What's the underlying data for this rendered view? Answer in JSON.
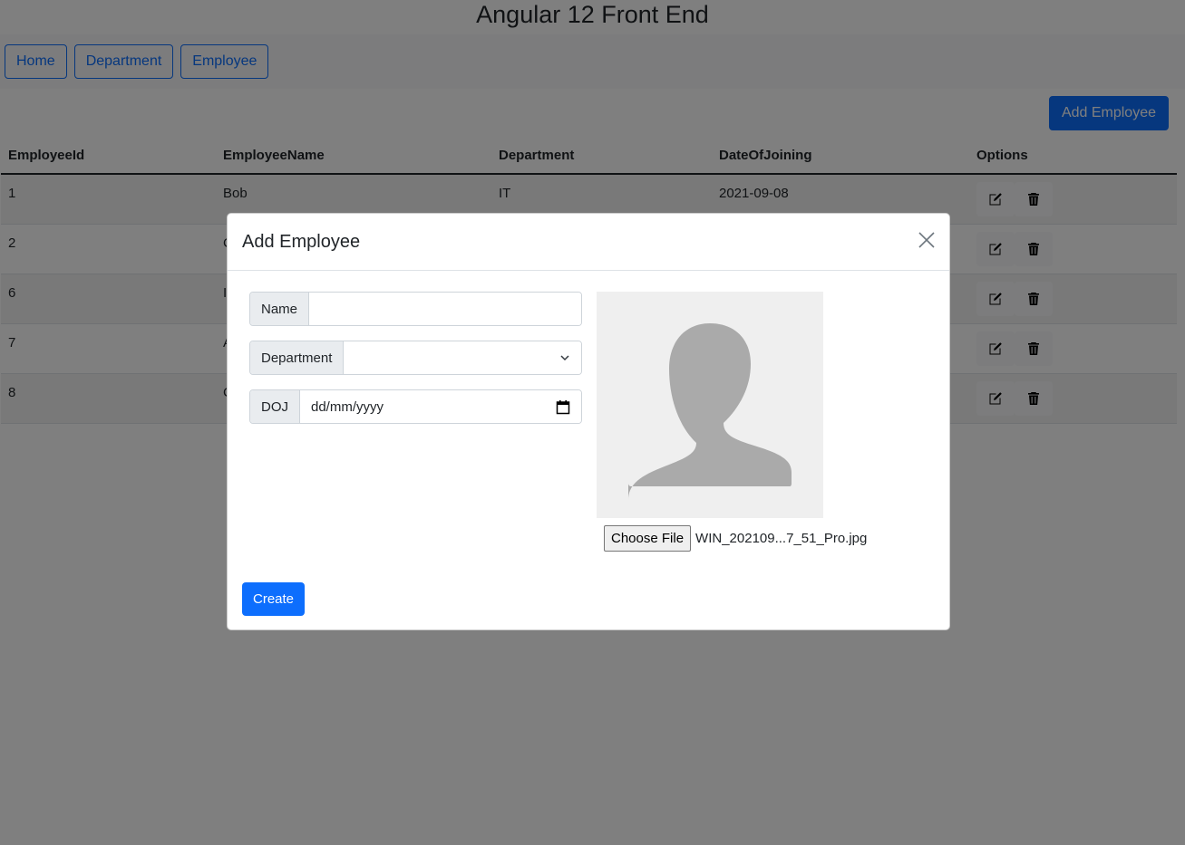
{
  "app": {
    "title": "Angular 12 Front End"
  },
  "nav": {
    "items": [
      {
        "label": "Home"
      },
      {
        "label": "Department"
      },
      {
        "label": "Employee"
      }
    ]
  },
  "toolbar": {
    "add_label": "Add Employee"
  },
  "table": {
    "columns": [
      "EmployeeId",
      "EmployeeName",
      "Department",
      "DateOfJoining",
      "Options"
    ],
    "rows": [
      {
        "id": "1",
        "name": "Bob",
        "department": "IT",
        "doj": "2021-09-08"
      },
      {
        "id": "2",
        "name": "C",
        "department": "",
        "doj": ""
      },
      {
        "id": "6",
        "name": "I",
        "department": "",
        "doj": ""
      },
      {
        "id": "7",
        "name": "A",
        "department": "",
        "doj": ""
      },
      {
        "id": "8",
        "name": "C",
        "department": "",
        "doj": ""
      }
    ],
    "row_actions": {
      "edit_icon": "edit-icon",
      "delete_icon": "trash-icon"
    }
  },
  "modal": {
    "title": "Add Employee",
    "close_icon": "close-icon",
    "fields": {
      "name": {
        "label": "Name",
        "value": ""
      },
      "department": {
        "label": "Department",
        "selected": ""
      },
      "doj": {
        "label": "DOJ",
        "placeholder": "dd/mm/yyyy"
      }
    },
    "photo": {
      "icon": "person-silhouette-icon"
    },
    "file": {
      "button_label": "Choose File",
      "file_name": "WIN_202109...7_51_Pro.jpg"
    },
    "create_label": "Create"
  },
  "colors": {
    "primary": "#0d6efd",
    "backdrop": "#000000",
    "placeholder_bg": "#efefef",
    "silhouette": "#aaaaaa"
  }
}
